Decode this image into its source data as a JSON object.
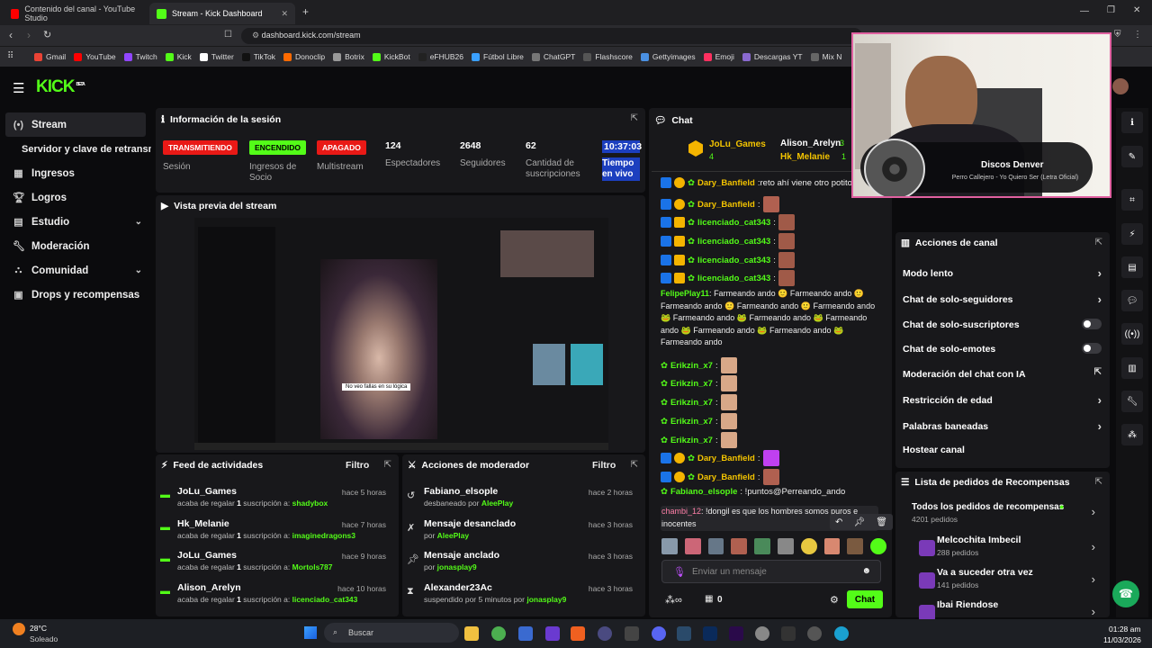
{
  "browser": {
    "tabs": [
      {
        "label": "Contenido del canal - YouTube Studio",
        "icon": "youtube-icon"
      },
      {
        "label": "Stream - Kick Dashboard",
        "icon": "kick-icon"
      }
    ],
    "url": "dashboard.kick.com/stream",
    "bookmarks": [
      "Gmail",
      "YouTube",
      "Twitch",
      "Kick",
      "Twitter",
      "TikTok",
      "Donoclip",
      "Botrix",
      "KickBot",
      "eFHUB26",
      "Fútbol Libre",
      "ChatGPT",
      "Flashscore",
      "Gettyimages",
      "Emoji",
      "Descargas YT",
      "Mix N"
    ]
  },
  "kick": {
    "logo": "KICK",
    "logo_beta": "BETA"
  },
  "sidebar": {
    "items": [
      {
        "label": "Stream",
        "icon": "stream-icon"
      },
      {
        "label": "Servidor y clave de retransmisión",
        "icon": ""
      },
      {
        "label": "Ingresos",
        "icon": "revenue-icon"
      },
      {
        "label": "Logros",
        "icon": "trophy-icon"
      },
      {
        "label": "Estudio",
        "icon": "studio-icon"
      },
      {
        "label": "Moderación",
        "icon": "wrench-icon"
      },
      {
        "label": "Comunidad",
        "icon": "community-icon"
      },
      {
        "label": "Drops y recompensas",
        "icon": "drops-icon"
      }
    ]
  },
  "session": {
    "title": "Información de la sesión",
    "stats": [
      {
        "badge": "TRANSMITIENDO",
        "label": "Sesión"
      },
      {
        "badge": "ENCENDIDO",
        "label": "Ingresos de Socio"
      },
      {
        "badge": "APAGADO",
        "label": "Multistream"
      },
      {
        "value": "124",
        "label": "Espectadores"
      },
      {
        "value": "2648",
        "label": "Seguidores"
      },
      {
        "value": "62",
        "label": "Cantidad de suscripciones"
      },
      {
        "value": "10:37:03",
        "label": "Tiempo en vivo"
      }
    ]
  },
  "preview": {
    "title": "Vista previa del stream",
    "caption": "No veo fallas en su lógica"
  },
  "feed": {
    "title": "Feed de actividades",
    "filter": "Filtro",
    "rows": [
      {
        "name": "JoLu_Games",
        "time": "hace 5 horas",
        "desc": "acaba de regalar ",
        "count": "1",
        "desc2": " suscripción a: ",
        "target": "shadybox"
      },
      {
        "name": "Hk_Melanie",
        "time": "hace 7 horas",
        "desc": "acaba de regalar ",
        "count": "1",
        "desc2": " suscripción a: ",
        "target": "imaginedragons3"
      },
      {
        "name": "JoLu_Games",
        "time": "hace 9 horas",
        "desc": "acaba de regalar ",
        "count": "1",
        "desc2": " suscripción a: ",
        "target": "Mortols787"
      },
      {
        "name": "Alison_Arelyn",
        "time": "hace 10 horas",
        "desc": "acaba de regalar ",
        "count": "1",
        "desc2": " suscripción a: ",
        "target": "licenciado_cat343"
      }
    ]
  },
  "modactions": {
    "title": "Acciones de moderador",
    "filter": "Filtro",
    "rows": [
      {
        "name": "Fabiano_elsople",
        "time": "hace 2 horas",
        "desc": "desbaneado por ",
        "target": "AleePlay"
      },
      {
        "name": "Mensaje desanclado",
        "time": "hace 3 horas",
        "desc": "por ",
        "target": "AleePlay"
      },
      {
        "name": "Mensaje anclado",
        "time": "hace 3 horas",
        "desc": "por ",
        "target": "jonasplay9"
      },
      {
        "name": "Alexander23Ac",
        "time": "hace 3 horas",
        "desc": "suspendido por 5 minutos por ",
        "target": "jonasplay9"
      }
    ]
  },
  "chat": {
    "title": "Chat",
    "top_gifters": [
      {
        "name": "JoLu_Games",
        "count": "4"
      },
      {
        "name": "Alison_Arelyn",
        "count": "3"
      },
      {
        "name": "Hk_Melanie",
        "count": "1"
      }
    ],
    "messages": [
      {
        "user": "Dary_Banfield",
        "text": ":reto ahí viene otro potito"
      },
      {
        "user": "Dary_Banfield",
        "text": ":"
      },
      {
        "user": "licenciado_cat343",
        "text": ":"
      },
      {
        "user": "licenciado_cat343",
        "text": ":"
      },
      {
        "user": "licenciado_cat343",
        "text": ":"
      },
      {
        "user": "licenciado_cat343",
        "text": ":"
      },
      {
        "user": "Erikzin_x7",
        "text": ":"
      },
      {
        "user": "Erikzin_x7",
        "text": ":"
      },
      {
        "user": "Erikzin_x7",
        "text": ":"
      },
      {
        "user": "Erikzin_x7",
        "text": ":"
      },
      {
        "user": "Erikzin_x7",
        "text": ":"
      },
      {
        "user": "Dary_Banfield",
        "text": ":"
      },
      {
        "user": "Dary_Banfield",
        "text": ":"
      },
      {
        "user": "Fabiano_elsople",
        "text": ": !puntos@Perreando_ando"
      }
    ],
    "farm_user": "FelipePlay11",
    "farm_text": "Farmeando ando",
    "last_user": "chambi_12",
    "last_text": ": !dongil es que los hombres somos puros e",
    "last_text2": "inocentes",
    "input_placeholder": "Enviar un mensaje",
    "points": "0",
    "send_label": "Chat"
  },
  "overlay": {
    "song_title": "Discos Denver",
    "song_artist": "Perro Callejero - Yo Quiero Ser (Letra Oficial)"
  },
  "channel_actions": {
    "title": "Acciones de canal",
    "items": [
      {
        "label": "Modo lento",
        "control": "chevron"
      },
      {
        "label": "Chat de solo-seguidores",
        "control": "chevron"
      },
      {
        "label": "Chat de solo-suscriptores",
        "control": "toggle"
      },
      {
        "label": "Chat de solo-emotes",
        "control": "toggle"
      },
      {
        "label": "Moderación del chat con IA",
        "control": "external"
      },
      {
        "label": "Restricción de edad",
        "control": "chevron"
      },
      {
        "label": "Palabras baneadas",
        "control": "chevron"
      },
      {
        "label": "Hostear canal",
        "control": "none"
      }
    ]
  },
  "rewards": {
    "title": "Lista de pedidos de Recompensas",
    "items": [
      {
        "name": "Todos los pedidos de recompensas",
        "count": "4201 pedidos"
      },
      {
        "name": "Melcochita Imbecil",
        "count": "288 pedidos"
      },
      {
        "name": "Va a suceder otra vez",
        "count": "141 pedidos"
      },
      {
        "name": "Ibai Riendose",
        "count": ""
      }
    ]
  },
  "taskbar": {
    "weather_temp": "28°C",
    "weather_desc": "Soleado",
    "search": "Buscar",
    "time": "01:28 am",
    "date": "11/03/2026"
  },
  "colors": {
    "accent": "#53fc18",
    "live_red": "#e91916",
    "panel": "#18181b"
  }
}
